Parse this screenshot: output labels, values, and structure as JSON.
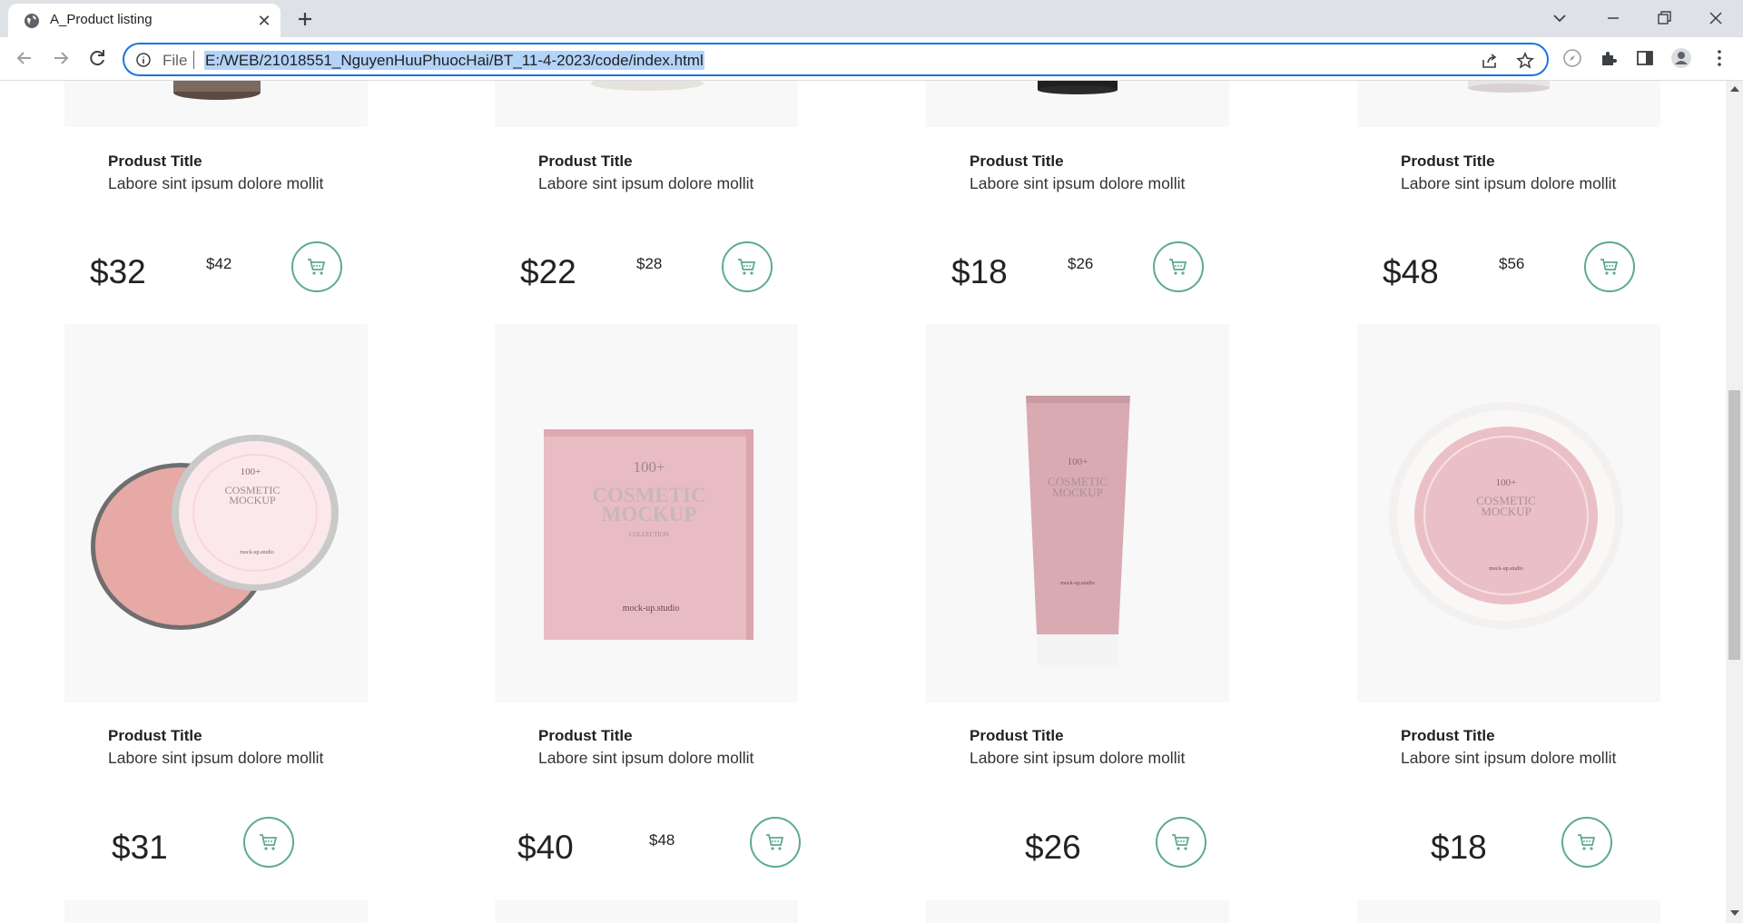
{
  "browser": {
    "tab_title": "A_Product listing",
    "scheme_label": "File",
    "url": "E:/WEB/21018551_NguyenHuuPhuocHai/BT_11-4-2023/code/index.html"
  },
  "products": [
    {
      "title": "Produst Title",
      "desc": "Labore sint ipsum dolore mollit",
      "price": "$32",
      "old_price": "$42"
    },
    {
      "title": "Produst Title",
      "desc": "Labore sint ipsum dolore mollit",
      "price": "$22",
      "old_price": "$28"
    },
    {
      "title": "Produst Title",
      "desc": "Labore sint ipsum dolore mollit",
      "price": "$18",
      "old_price": "$26"
    },
    {
      "title": "Produst Title",
      "desc": "Labore sint ipsum dolore mollit",
      "price": "$48",
      "old_price": "$56"
    },
    {
      "title": "Produst Title",
      "desc": "Labore sint ipsum dolore mollit",
      "price": "$31",
      "old_price": "",
      "image_text": [
        "100+",
        "COSMETIC",
        "MOCKUP",
        "mock-up.studio"
      ]
    },
    {
      "title": "Produst Title",
      "desc": "Labore sint ipsum dolore mollit",
      "price": "$40",
      "old_price": "$48",
      "image_text": [
        "100+",
        "COSMETIC",
        "MOCKUP",
        "COLLECTION",
        "mock-up.studio"
      ]
    },
    {
      "title": "Produst Title",
      "desc": "Labore sint ipsum dolore mollit",
      "price": "$26",
      "old_price": "",
      "image_text": [
        "100+",
        "COSMETIC",
        "MOCKUP",
        "mock-up.studio"
      ]
    },
    {
      "title": "Produst Title",
      "desc": "Labore sint ipsum dolore mollit",
      "price": "$18",
      "old_price": "",
      "image_text": [
        "100+",
        "COSMETIC",
        "MOCKUP",
        "mock-up.studio"
      ]
    }
  ],
  "colors": {
    "accent": "#5dab8c",
    "card_bg": "#f8f8f8",
    "product_pink": "#e8bcc2"
  }
}
